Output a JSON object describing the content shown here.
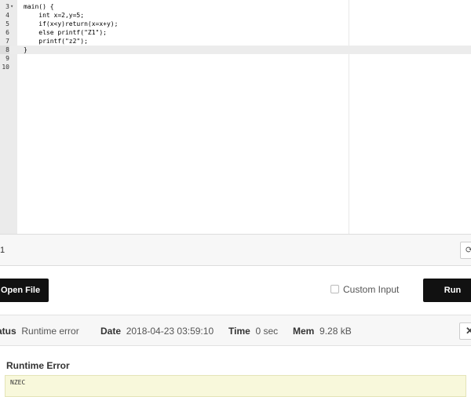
{
  "editor": {
    "lines": [
      {
        "num": "3",
        "fold": "▾",
        "code": "main() {",
        "active": false
      },
      {
        "num": "4",
        "fold": "",
        "code": "    int x=2,y=5;",
        "active": false
      },
      {
        "num": "5",
        "fold": "",
        "code": "    if(x<y)return(x=x+y);",
        "active": false
      },
      {
        "num": "6",
        "fold": "",
        "code": "    else printf(\"Z1\");",
        "active": false
      },
      {
        "num": "7",
        "fold": "",
        "code": "    printf(\"z2\");",
        "active": false
      },
      {
        "num": "8",
        "fold": "",
        "code": "}",
        "active": true
      },
      {
        "num": "9",
        "fold": "",
        "code": "",
        "active": false
      },
      {
        "num": "10",
        "fold": "",
        "code": "",
        "active": false
      }
    ]
  },
  "tabbar": {
    "label": "1",
    "refresh_icon": "refresh-icon",
    "refresh_glyph": "⟳"
  },
  "actions": {
    "open_file": "Open File",
    "custom_input": "Custom Input",
    "run": "Run"
  },
  "status": {
    "status_label": "Status",
    "status_value": "Runtime error",
    "date_label": "Date",
    "date_value": "2018-04-23 03:59:10",
    "time_label": "Time",
    "time_value": "0 sec",
    "mem_label": "Mem",
    "mem_value": "9.28 kB",
    "close_icon": "close-icon",
    "close_glyph": "✕"
  },
  "error": {
    "title": "Runtime Error",
    "text": "NZEC"
  }
}
